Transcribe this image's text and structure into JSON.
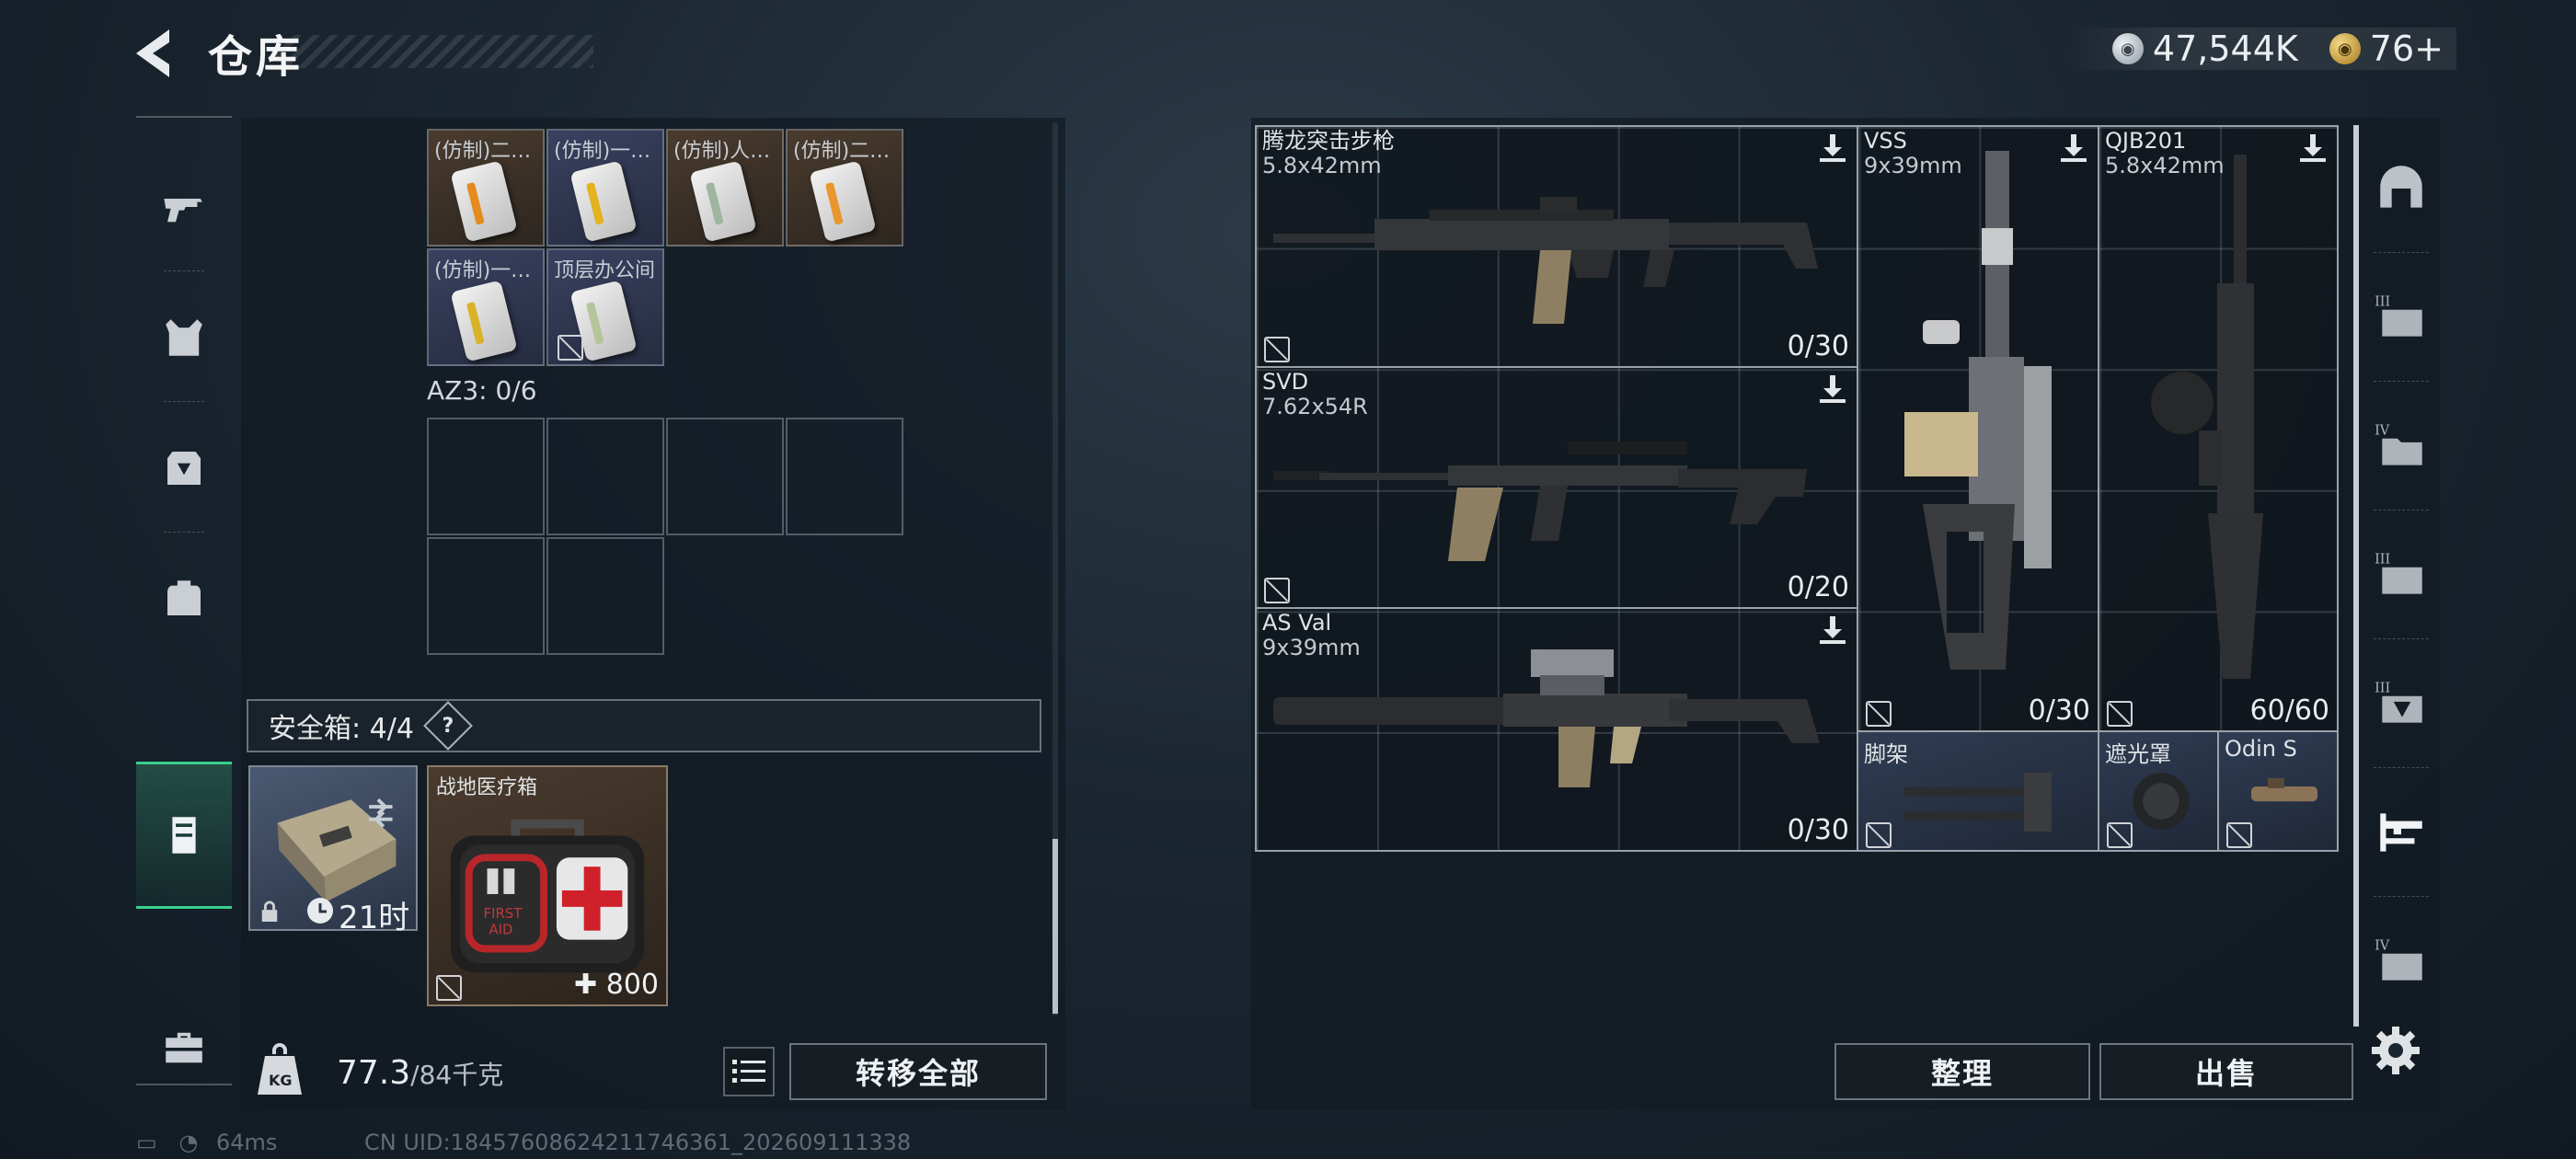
{
  "header": {
    "title": "仓库",
    "currency_silver": "47,544K",
    "currency_gold": "76+"
  },
  "left_nav": {
    "items": [
      "gun-icon",
      "vest-icon",
      "armor-icon",
      "backpack-icon",
      "safebox-icon",
      "toolbox-icon"
    ],
    "active": "safebox-icon"
  },
  "left_panel": {
    "keycards": [
      {
        "name": "(仿制)二…",
        "bg": "brown",
        "strip": "#e48a1e"
      },
      {
        "name": "(仿制)一…",
        "bg": "blue",
        "strip": "#e3b21e"
      },
      {
        "name": "(仿制)人…",
        "bg": "brown",
        "strip": "#9fb5a0"
      },
      {
        "name": "(仿制)二…",
        "bg": "brown",
        "strip": "#e8962d"
      },
      {
        "name": "(仿制)一…",
        "bg": "blue",
        "strip": "#d9b228"
      },
      {
        "name": "顶层办公间",
        "bg": "blue",
        "strip": "#b5c59b"
      }
    ],
    "az3_label": "AZ3: 0/6",
    "safebox_label": "安全箱: 4/4",
    "help_label": "?",
    "safe_case_time": "21时",
    "medkit_name": "战地医疗箱",
    "medkit_value": "800",
    "medkit_text": "FIRST AID",
    "weight_current": "77.3",
    "weight_max": "/84千克",
    "transfer_all": "转移全部"
  },
  "weapons": [
    {
      "name": "腾龙突击步枪",
      "caliber": "5.8x42mm",
      "ammo": "0/30"
    },
    {
      "name": "SVD",
      "caliber": "7.62x54R",
      "ammo": "0/20"
    },
    {
      "name": "AS Val",
      "caliber": "9x39mm",
      "ammo": "0/30"
    },
    {
      "name": "VSS",
      "caliber": "9x39mm",
      "ammo": "0/30"
    },
    {
      "name": "QJB201",
      "caliber": "5.8x42mm",
      "ammo": "60/60"
    }
  ],
  "accessories": [
    {
      "name": "脚架"
    },
    {
      "name": "遮光罩"
    },
    {
      "name": "Odin S"
    }
  ],
  "right_buttons": {
    "sort": "整理",
    "sell": "出售"
  },
  "right_nav": {
    "items": [
      "helmet-icon",
      "tier3-case-icon",
      "tier4-folder-icon",
      "tier3-case-b-icon",
      "tier3-box-icon",
      "weapon-rack-icon",
      "tier4-case-icon"
    ],
    "active": "weapon-rack-icon"
  },
  "status": {
    "ping": "64ms",
    "uid": "CN UID:18457608624211746361_202609111338"
  },
  "colors": {
    "accent_green": "#38d08e",
    "panel": "#121a22"
  }
}
